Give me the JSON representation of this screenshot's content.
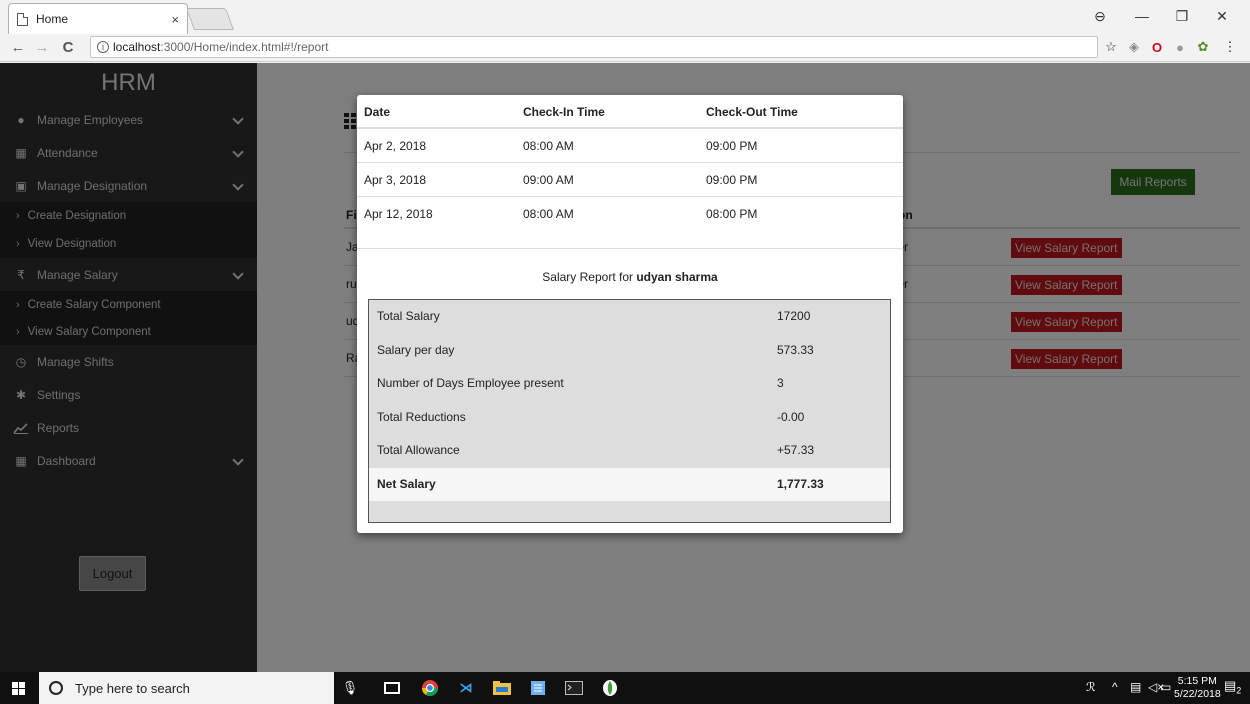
{
  "browser": {
    "tab_title": "Home",
    "tab_close": "×",
    "url_host": "localhost",
    "url_rest": ":3000/Home/index.html#!/report",
    "back": "←",
    "forward": "→",
    "reload": "C",
    "info": "i",
    "star": "☆",
    "minimize": "—",
    "maximize": "❐",
    "close": "✕",
    "profile": "⊖",
    "menu": "⋮"
  },
  "sidebar": {
    "brand": "HRM",
    "items": [
      {
        "label": "Manage Employees",
        "icon": "user-circle-icon",
        "glyph": "●",
        "chevron": true
      },
      {
        "label": "Attendance",
        "icon": "calendar-icon",
        "glyph": "▦",
        "chevron": true
      },
      {
        "label": "Manage Designation",
        "icon": "badge-icon",
        "glyph": "▣",
        "chevron": true
      }
    ],
    "designation_sub": [
      {
        "label": "Create Designation"
      },
      {
        "label": "View Designation"
      }
    ],
    "salary": {
      "label": "Manage Salary",
      "icon": "rupee-icon",
      "glyph": "₹"
    },
    "salary_sub": [
      {
        "label": "Create Salary Component"
      },
      {
        "label": "View Salary Component"
      }
    ],
    "items2": [
      {
        "label": "Manage Shifts",
        "icon": "clock-icon",
        "glyph": "◷"
      },
      {
        "label": "Settings",
        "icon": "gear-icon",
        "glyph": "✱"
      },
      {
        "label": "Reports",
        "icon": "chart-icon",
        "glyph": "📈"
      },
      {
        "label": "Dashboard",
        "icon": "calendar-check-icon",
        "glyph": "▦"
      }
    ],
    "arrow": "›",
    "logout": "Logout"
  },
  "main": {
    "mail_button": "Mail Reports",
    "table_headers": [
      "Fir",
      "ation"
    ],
    "rows": [
      {
        "first": "Jar",
        "designation": "ager",
        "action": "View Salary Report"
      },
      {
        "first": "rud",
        "designation": "ager",
        "action": "View Salary Report"
      },
      {
        "first": "udy",
        "designation": "",
        "action": "View Salary Report"
      },
      {
        "first": "Ra",
        "designation": "er",
        "action": "View Salary Report"
      }
    ]
  },
  "modal": {
    "attendance_headers": [
      "Date",
      "Check-In Time",
      "Check-Out Time"
    ],
    "attendance": [
      [
        "Apr 2, 2018",
        "08:00 AM",
        "09:00 PM"
      ],
      [
        "Apr 3, 2018",
        "09:00 AM",
        "09:00 PM"
      ],
      [
        "Apr 12, 2018",
        "08:00 AM",
        "08:00 PM"
      ]
    ],
    "salary_title_prefix": "Salary Report for ",
    "salary_title_name": "udyan sharma",
    "salary_rows": [
      [
        "Total Salary",
        "17200"
      ],
      [
        "Salary per day",
        "573.33"
      ],
      [
        "Number of Days Employee present",
        "3"
      ],
      [
        "Total Reductions",
        "-0.00"
      ],
      [
        "Total Allowance",
        "+57.33"
      ]
    ],
    "net": [
      "Net Salary",
      "1,777.33"
    ]
  },
  "taskbar": {
    "search_placeholder": "Type here to search",
    "time": "5:15 PM",
    "date": "5/22/2018",
    "notifications": "2"
  }
}
